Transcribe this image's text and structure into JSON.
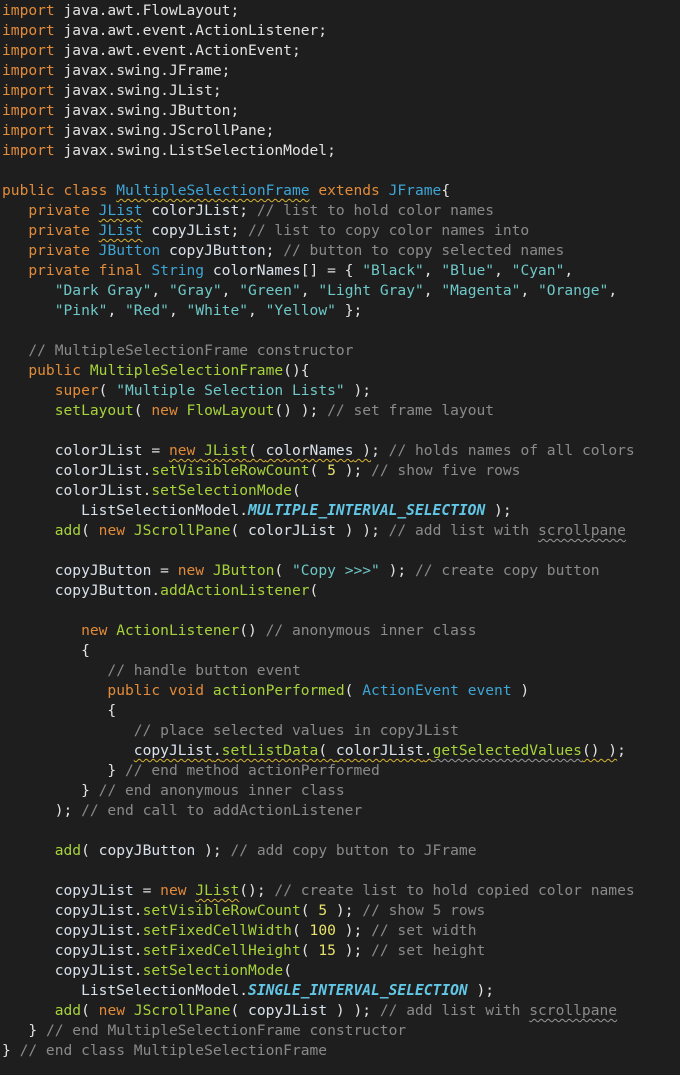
{
  "editor": {
    "theme": {
      "background": "#1e1e1e",
      "keyword": "#e28b39",
      "class_name": "#3ea5d6",
      "identifier": "#d9e1ea",
      "method": "#a6d33b",
      "string": "#6fc7c7",
      "number": "#eae36a",
      "comment": "#8a8a8a",
      "punctuation": "#e2e2e2",
      "constant": "#62c7e6"
    },
    "lines": [
      [
        {
          "t": "import",
          "c": "kw"
        },
        {
          "t": " java.awt.FlowLayout;",
          "c": "pu"
        }
      ],
      [
        {
          "t": "import",
          "c": "kw"
        },
        {
          "t": " java.awt.event.ActionListener;",
          "c": "pu"
        }
      ],
      [
        {
          "t": "import",
          "c": "kw"
        },
        {
          "t": " java.awt.event.ActionEvent;",
          "c": "pu"
        }
      ],
      [
        {
          "t": "import",
          "c": "kw"
        },
        {
          "t": " javax.swing.JFrame;",
          "c": "pu"
        }
      ],
      [
        {
          "t": "import",
          "c": "kw"
        },
        {
          "t": " javax.swing.JList;",
          "c": "pu"
        }
      ],
      [
        {
          "t": "import",
          "c": "kw"
        },
        {
          "t": " javax.swing.JButton;",
          "c": "pu"
        }
      ],
      [
        {
          "t": "import",
          "c": "kw"
        },
        {
          "t": " javax.swing.JScrollPane;",
          "c": "pu"
        }
      ],
      [
        {
          "t": "import",
          "c": "kw"
        },
        {
          "t": " javax.swing.ListSelectionModel;",
          "c": "pu"
        }
      ],
      [],
      [
        {
          "t": "public class ",
          "c": "kw"
        },
        {
          "t": "MultipleSelectionFrame",
          "c": "cls",
          "u": "y"
        },
        {
          "t": " extends ",
          "c": "kw"
        },
        {
          "t": "JFrame",
          "c": "cls"
        },
        {
          "t": "{",
          "c": "pu"
        }
      ],
      [
        {
          "t": "   private ",
          "c": "kw"
        },
        {
          "t": "JList",
          "c": "cls",
          "u": "y"
        },
        {
          "t": " colorJList",
          "c": "id"
        },
        {
          "t": "; ",
          "c": "pu"
        },
        {
          "t": "// list to hold color names",
          "c": "cm"
        }
      ],
      [
        {
          "t": "   private ",
          "c": "kw"
        },
        {
          "t": "JList",
          "c": "cls",
          "u": "y"
        },
        {
          "t": " copyJList",
          "c": "id"
        },
        {
          "t": "; ",
          "c": "pu"
        },
        {
          "t": "// list to copy color names into",
          "c": "cm"
        }
      ],
      [
        {
          "t": "   private ",
          "c": "kw"
        },
        {
          "t": "JButton",
          "c": "cls"
        },
        {
          "t": " copyJButton",
          "c": "id"
        },
        {
          "t": "; ",
          "c": "pu"
        },
        {
          "t": "// button to copy selected names",
          "c": "cm"
        }
      ],
      [
        {
          "t": "   private final ",
          "c": "kw"
        },
        {
          "t": "String",
          "c": "cls"
        },
        {
          "t": " colorNames",
          "c": "id"
        },
        {
          "t": "[] = { ",
          "c": "pu"
        },
        {
          "t": "\"Black\"",
          "c": "str"
        },
        {
          "t": ", ",
          "c": "pu"
        },
        {
          "t": "\"Blue\"",
          "c": "str"
        },
        {
          "t": ", ",
          "c": "pu"
        },
        {
          "t": "\"Cyan\"",
          "c": "str"
        },
        {
          "t": ",",
          "c": "pu"
        }
      ],
      [
        {
          "t": "      ",
          "c": "pu"
        },
        {
          "t": "\"Dark Gray\"",
          "c": "str"
        },
        {
          "t": ", ",
          "c": "pu"
        },
        {
          "t": "\"Gray\"",
          "c": "str"
        },
        {
          "t": ", ",
          "c": "pu"
        },
        {
          "t": "\"Green\"",
          "c": "str"
        },
        {
          "t": ", ",
          "c": "pu"
        },
        {
          "t": "\"Light Gray\"",
          "c": "str"
        },
        {
          "t": ", ",
          "c": "pu"
        },
        {
          "t": "\"Magenta\"",
          "c": "str"
        },
        {
          "t": ", ",
          "c": "pu"
        },
        {
          "t": "\"Orange\"",
          "c": "str"
        },
        {
          "t": ",",
          "c": "pu"
        }
      ],
      [
        {
          "t": "      ",
          "c": "pu"
        },
        {
          "t": "\"Pink\"",
          "c": "str"
        },
        {
          "t": ", ",
          "c": "pu"
        },
        {
          "t": "\"Red\"",
          "c": "str"
        },
        {
          "t": ", ",
          "c": "pu"
        },
        {
          "t": "\"White\"",
          "c": "str"
        },
        {
          "t": ", ",
          "c": "pu"
        },
        {
          "t": "\"Yellow\"",
          "c": "str"
        },
        {
          "t": " };",
          "c": "pu"
        }
      ],
      [],
      [
        {
          "t": "   // MultipleSelectionFrame constructor",
          "c": "cm"
        }
      ],
      [
        {
          "t": "   public ",
          "c": "kw"
        },
        {
          "t": "MultipleSelectionFrame",
          "c": "fn"
        },
        {
          "t": "(){",
          "c": "pu"
        }
      ],
      [
        {
          "t": "      super",
          "c": "kw"
        },
        {
          "t": "( ",
          "c": "pu"
        },
        {
          "t": "\"Multiple Selection Lists\"",
          "c": "str"
        },
        {
          "t": " );",
          "c": "pu"
        }
      ],
      [
        {
          "t": "      setLayout",
          "c": "fn"
        },
        {
          "t": "( ",
          "c": "pu"
        },
        {
          "t": "new ",
          "c": "kw"
        },
        {
          "t": "FlowLayout",
          "c": "fn"
        },
        {
          "t": "() ); ",
          "c": "pu"
        },
        {
          "t": "// set frame layout",
          "c": "cm"
        }
      ],
      [],
      [
        {
          "t": "      colorJList",
          "c": "id"
        },
        {
          "t": " = ",
          "c": "pu"
        },
        {
          "t": "new JList( colorNames );",
          "c": "fn",
          "seg": [
            {
              "t": "new",
              "c": "kw",
              "u": "y"
            },
            {
              "t": " ",
              "c": "pu",
              "u": "y"
            },
            {
              "t": "JList",
              "c": "fn",
              "u": "y"
            },
            {
              "t": "( ",
              "c": "pu",
              "u": "y"
            },
            {
              "t": "colorNames",
              "c": "id",
              "u": "y"
            },
            {
              "t": " )",
              "c": "pu",
              "u": "y"
            },
            {
              "t": ";",
              "c": "pu"
            }
          ]
        },
        {
          "t": " // holds names of all colors",
          "c": "cm"
        }
      ],
      [
        {
          "t": "      colorJList",
          "c": "id"
        },
        {
          "t": ".",
          "c": "pu"
        },
        {
          "t": "setVisibleRowCount",
          "c": "fn"
        },
        {
          "t": "( ",
          "c": "pu"
        },
        {
          "t": "5",
          "c": "num"
        },
        {
          "t": " ); ",
          "c": "pu"
        },
        {
          "t": "// show five rows",
          "c": "cm"
        }
      ],
      [
        {
          "t": "      colorJList",
          "c": "id"
        },
        {
          "t": ".",
          "c": "pu"
        },
        {
          "t": "setSelectionMode",
          "c": "fn"
        },
        {
          "t": "(",
          "c": "pu"
        }
      ],
      [
        {
          "t": "         ListSelectionModel",
          "c": "id"
        },
        {
          "t": ".",
          "c": "pu"
        },
        {
          "t": "MULTIPLE_INTERVAL_SELECTION",
          "c": "const"
        },
        {
          "t": " );",
          "c": "pu"
        }
      ],
      [
        {
          "t": "      add",
          "c": "fn"
        },
        {
          "t": "( ",
          "c": "pu"
        },
        {
          "t": "new ",
          "c": "kw"
        },
        {
          "t": "JScrollPane",
          "c": "fn"
        },
        {
          "t": "( ",
          "c": "pu"
        },
        {
          "t": "colorJList",
          "c": "id"
        },
        {
          "t": " ) ); ",
          "c": "pu"
        },
        {
          "t": "// add list with ",
          "c": "cm"
        },
        {
          "t": "scrollpane",
          "c": "cm",
          "u": "g"
        }
      ],
      [],
      [
        {
          "t": "      copyJButton",
          "c": "id"
        },
        {
          "t": " = ",
          "c": "pu"
        },
        {
          "t": "new ",
          "c": "kw"
        },
        {
          "t": "JButton",
          "c": "fn"
        },
        {
          "t": "( ",
          "c": "pu"
        },
        {
          "t": "\"Copy >>>\"",
          "c": "str"
        },
        {
          "t": " ); ",
          "c": "pu"
        },
        {
          "t": "// create copy button",
          "c": "cm"
        }
      ],
      [
        {
          "t": "      copyJButton",
          "c": "id"
        },
        {
          "t": ".",
          "c": "pu"
        },
        {
          "t": "addActionListener",
          "c": "fn"
        },
        {
          "t": "(",
          "c": "pu"
        }
      ],
      [],
      [
        {
          "t": "         new ",
          "c": "kw"
        },
        {
          "t": "ActionListener",
          "c": "fn"
        },
        {
          "t": "() ",
          "c": "pu"
        },
        {
          "t": "// anonymous inner class",
          "c": "cm"
        }
      ],
      [
        {
          "t": "         {",
          "c": "pu"
        }
      ],
      [
        {
          "t": "            // handle button event",
          "c": "cm"
        }
      ],
      [
        {
          "t": "            public void ",
          "c": "kw"
        },
        {
          "t": "actionPerformed",
          "c": "fn"
        },
        {
          "t": "( ",
          "c": "pu"
        },
        {
          "t": "ActionEvent",
          "c": "cls"
        },
        {
          "t": " event",
          "c": "cls"
        },
        {
          "t": " )",
          "c": "pu"
        }
      ],
      [
        {
          "t": "            {",
          "c": "pu"
        }
      ],
      [
        {
          "t": "               // place selected values in copyJList",
          "c": "cm"
        }
      ],
      [
        {
          "t": "               ",
          "c": "pu"
        },
        {
          "t": "copyJList",
          "c": "id",
          "u": "y"
        },
        {
          "t": ".",
          "c": "pu",
          "u": "y"
        },
        {
          "t": "setListData",
          "c": "fn",
          "u": "y"
        },
        {
          "t": "( ",
          "c": "pu",
          "u": "y"
        },
        {
          "t": "colorJList",
          "c": "id",
          "u": "y"
        },
        {
          "t": ".",
          "c": "pu",
          "u": "y"
        },
        {
          "t": "getSelectedValues",
          "c": "fn",
          "u": "g"
        },
        {
          "t": "() )",
          "c": "pu",
          "u": "y"
        },
        {
          "t": ";",
          "c": "pu"
        }
      ],
      [
        {
          "t": "            } ",
          "c": "pu"
        },
        {
          "t": "// end method actionPerformed",
          "c": "cm"
        }
      ],
      [
        {
          "t": "         } ",
          "c": "pu"
        },
        {
          "t": "// end anonymous inner class",
          "c": "cm"
        }
      ],
      [
        {
          "t": "      ); ",
          "c": "pu"
        },
        {
          "t": "// end call to addActionListener",
          "c": "cm"
        }
      ],
      [],
      [
        {
          "t": "      add",
          "c": "fn"
        },
        {
          "t": "( ",
          "c": "pu"
        },
        {
          "t": "copyJButton",
          "c": "id"
        },
        {
          "t": " ); ",
          "c": "pu"
        },
        {
          "t": "// add copy button to JFrame",
          "c": "cm"
        }
      ],
      [],
      [
        {
          "t": "      copyJList",
          "c": "id"
        },
        {
          "t": " = ",
          "c": "pu"
        },
        {
          "t": "new ",
          "c": "kw"
        },
        {
          "t": "JList",
          "c": "fn",
          "u": "y"
        },
        {
          "t": "(); ",
          "c": "pu"
        },
        {
          "t": "// create list to hold copied color names",
          "c": "cm"
        }
      ],
      [
        {
          "t": "      copyJList",
          "c": "id"
        },
        {
          "t": ".",
          "c": "pu"
        },
        {
          "t": "setVisibleRowCount",
          "c": "fn"
        },
        {
          "t": "( ",
          "c": "pu"
        },
        {
          "t": "5",
          "c": "num"
        },
        {
          "t": " ); ",
          "c": "pu"
        },
        {
          "t": "// show 5 rows",
          "c": "cm"
        }
      ],
      [
        {
          "t": "      copyJList",
          "c": "id"
        },
        {
          "t": ".",
          "c": "pu"
        },
        {
          "t": "setFixedCellWidth",
          "c": "fn"
        },
        {
          "t": "( ",
          "c": "pu"
        },
        {
          "t": "100",
          "c": "num"
        },
        {
          "t": " ); ",
          "c": "pu"
        },
        {
          "t": "// set width",
          "c": "cm"
        }
      ],
      [
        {
          "t": "      copyJList",
          "c": "id"
        },
        {
          "t": ".",
          "c": "pu"
        },
        {
          "t": "setFixedCellHeight",
          "c": "fn"
        },
        {
          "t": "( ",
          "c": "pu"
        },
        {
          "t": "15",
          "c": "num"
        },
        {
          "t": " ); ",
          "c": "pu"
        },
        {
          "t": "// set height",
          "c": "cm"
        }
      ],
      [
        {
          "t": "      copyJList",
          "c": "id"
        },
        {
          "t": ".",
          "c": "pu"
        },
        {
          "t": "setSelectionMode",
          "c": "fn"
        },
        {
          "t": "(",
          "c": "pu"
        }
      ],
      [
        {
          "t": "         ListSelectionModel",
          "c": "id"
        },
        {
          "t": ".",
          "c": "pu"
        },
        {
          "t": "SINGLE_INTERVAL_SELECTION",
          "c": "const"
        },
        {
          "t": " );",
          "c": "pu"
        }
      ],
      [
        {
          "t": "      add",
          "c": "fn"
        },
        {
          "t": "( ",
          "c": "pu"
        },
        {
          "t": "new ",
          "c": "kw"
        },
        {
          "t": "JScrollPane",
          "c": "fn"
        },
        {
          "t": "( ",
          "c": "pu"
        },
        {
          "t": "copyJList",
          "c": "id"
        },
        {
          "t": " ) ); ",
          "c": "pu"
        },
        {
          "t": "// add list with ",
          "c": "cm"
        },
        {
          "t": "scrollpane",
          "c": "cm",
          "u": "g"
        }
      ],
      [
        {
          "t": "   } ",
          "c": "pu"
        },
        {
          "t": "// end MultipleSelectionFrame constructor",
          "c": "cm"
        }
      ],
      [
        {
          "t": "} ",
          "c": "pu"
        },
        {
          "t": "// end class MultipleSelectionFrame",
          "c": "cm"
        }
      ]
    ]
  }
}
